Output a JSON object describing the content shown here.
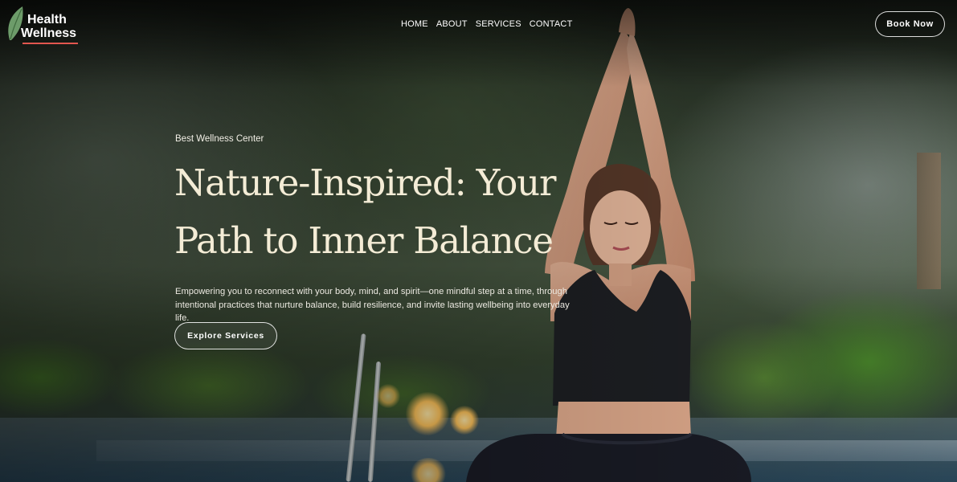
{
  "brand": {
    "line1": "Health",
    "line2": "Wellness",
    "accent_color": "#e2564f",
    "icon": "leaf-icon"
  },
  "nav": {
    "items": [
      {
        "label": "HOME"
      },
      {
        "label": "ABOUT"
      },
      {
        "label": "SERVICES"
      },
      {
        "label": "CONTACT"
      }
    ]
  },
  "header": {
    "cta_label": "Book Now"
  },
  "hero": {
    "eyebrow": "Best Wellness Center",
    "title_line1": "Nature-Inspired: Your",
    "title_line2": "Path to Inner Balance",
    "description": "Empowering you to reconnect with your body, mind, and spirit—one mindful step at a time, through intentional practices that nurture balance, build resilience, and invite lasting wellbeing into everyday life.",
    "cta_label": "Explore Services",
    "title_color": "#f4ecd6"
  }
}
